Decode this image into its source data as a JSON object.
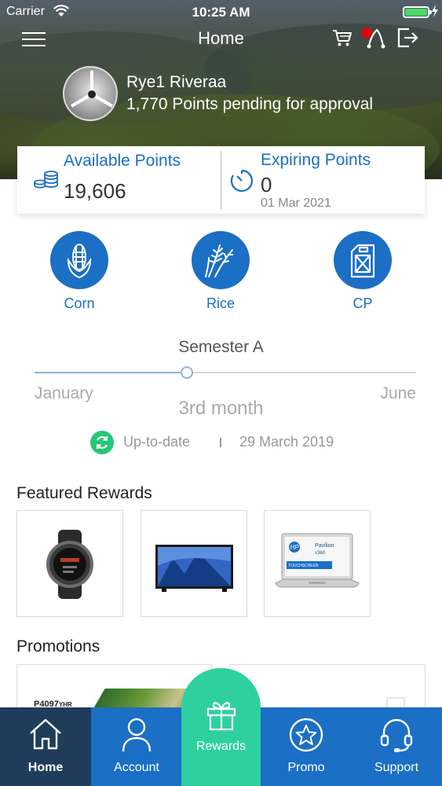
{
  "status_bar": {
    "carrier": "Carrier",
    "time": "10:25 AM",
    "battery_color": "#4cd964"
  },
  "nav": {
    "title": "Home",
    "icons": [
      "menu-icon",
      "cart-icon",
      "route-icon",
      "logout-icon"
    ],
    "badge_color": "#e00012"
  },
  "profile": {
    "name": "Rye1 Riveraa",
    "pending": "1,770 Points pending for approval"
  },
  "points": {
    "available_label": "Available Points",
    "available_value": "19,606",
    "expiring_label": "Expiring Points",
    "expiring_value": "0",
    "expiring_date": "01 Mar 2021"
  },
  "categories": [
    {
      "label": "Corn",
      "icon": "corn-icon"
    },
    {
      "label": "Rice",
      "icon": "rice-icon"
    },
    {
      "label": "CP",
      "icon": "jerrycan-icon"
    }
  ],
  "semester": {
    "title": "Semester A",
    "start": "January",
    "end": "June",
    "current": "3rd month",
    "progress": 0.4,
    "status": "Up-to-date",
    "date": "29 March 2019"
  },
  "featured": {
    "title": "Featured Rewards",
    "items": [
      {
        "icon": "smartwatch-icon"
      },
      {
        "icon": "television-icon"
      },
      {
        "icon": "laptop-icon",
        "brand": "HP",
        "model_line1": "Pavilion",
        "model_line2": "x360",
        "screen_text": "TOUCHSCREEN"
      }
    ]
  },
  "promotions": {
    "title": "Promotions",
    "code": "P4097",
    "code_suffix": "YHR"
  },
  "tabs": {
    "home": "Home",
    "account": "Account",
    "rewards": "Rewards",
    "promo": "Promo",
    "support": "Support"
  },
  "colors": {
    "primary": "#1b6fc4",
    "active_tab": "#1f3d5a",
    "rewards_tab": "#2fd0a0",
    "up_to_date": "#26c777"
  }
}
